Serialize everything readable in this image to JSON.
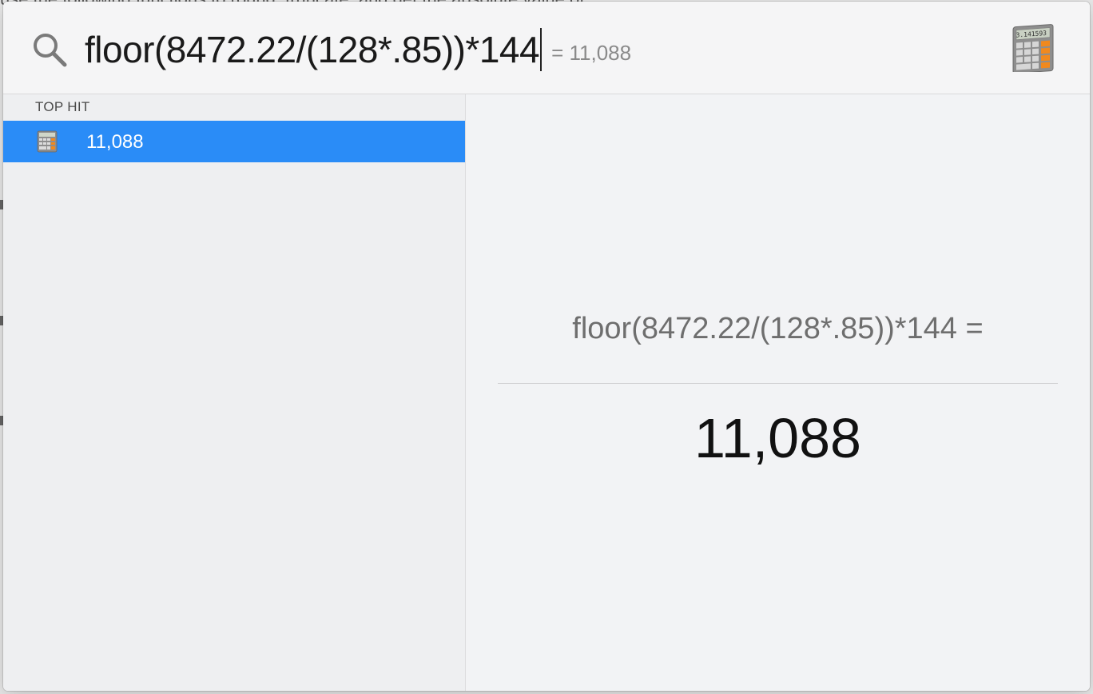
{
  "background": {
    "partial_text": "use the following functions to round, truncate, and get the absolute value of"
  },
  "search": {
    "query": "floor(8472.22/(128*.85))*144",
    "inline_result": "= 11,088",
    "icon": "search-icon"
  },
  "app_icon": {
    "name": "calculator-icon",
    "display_digits": "3.141593"
  },
  "results": {
    "section_header": "TOP HIT",
    "items": [
      {
        "label": "11,088",
        "icon": "calculator-icon",
        "selected": true
      }
    ]
  },
  "preview": {
    "expression": "floor(8472.22/(128*.85))*144 =",
    "result": "11,088"
  },
  "colors": {
    "selection": "#2a8cf7",
    "calculator_orange": "#f0891e"
  }
}
